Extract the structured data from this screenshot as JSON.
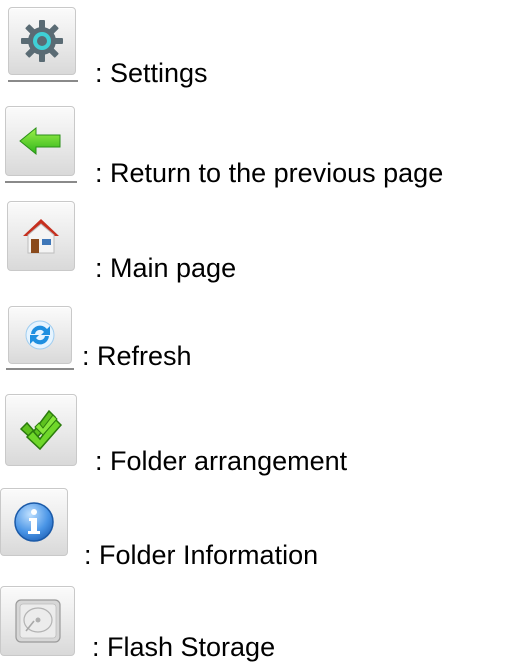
{
  "legend": [
    {
      "icon": "gear-icon",
      "label": ": Settings"
    },
    {
      "icon": "back-arrow-icon",
      "label": ": Return to the previous page"
    },
    {
      "icon": "home-icon",
      "label": ": Main page"
    },
    {
      "icon": "refresh-icon",
      "label": ": Refresh"
    },
    {
      "icon": "checkmarks-icon",
      "label": ": Folder arrangement"
    },
    {
      "icon": "info-icon",
      "label": ": Folder Information"
    },
    {
      "icon": "hard-drive-icon",
      "label": ": Flash Storage"
    }
  ]
}
